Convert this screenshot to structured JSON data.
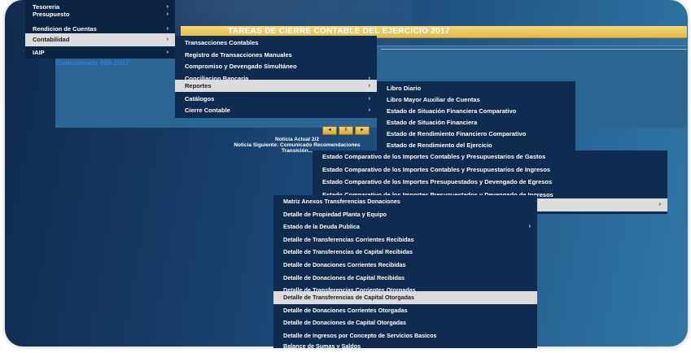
{
  "title": "TAREAS DE CIERRE CONTABLE DEL EJERCICIO 2017",
  "comunicado": "Comunicado 005-2017",
  "player": {
    "prev": "◄",
    "pause": "II",
    "next": "►"
  },
  "news": {
    "actual": "Noticia Actual 2/2",
    "siguiente": "Noticia Siguiente: Comunicado Recomendaciones",
    "transicion": "Transición..."
  },
  "menu_main": [
    {
      "label": "Tesoreria",
      "arrow": "›"
    },
    {
      "label": "Presupuesto",
      "arrow": "›"
    },
    {
      "label": "Rendicion de Cuentas",
      "arrow": "›"
    },
    {
      "label": "Contabilidad",
      "arrow": "›"
    },
    {
      "label": "IAIP",
      "arrow": "›"
    }
  ],
  "menu_contabilidad": [
    {
      "label": "Transacciones Contables",
      "arrow": ""
    },
    {
      "label": "Registro de Transacciones Manuales",
      "arrow": ""
    },
    {
      "label": "Compromiso y Devengado Simultáneo",
      "arrow": ""
    },
    {
      "label": "Conciliacion Bancaria",
      "arrow": "›"
    },
    {
      "label": "Reportes",
      "arrow": "›"
    },
    {
      "label": "Catálogos",
      "arrow": "›"
    },
    {
      "label": "Cierre Contable",
      "arrow": "›"
    }
  ],
  "menu_reportes": [
    {
      "label": "Libro Diario"
    },
    {
      "label": "Libro Mayor Auxiliar de Cuentas"
    },
    {
      "label": "Estado de Situación Financiera Comparativo"
    },
    {
      "label": "Estado de Situación Financiera"
    },
    {
      "label": "Estado de Rendimiento Financiero Comparativo"
    },
    {
      "label": "Estado de Rendimiento del Ejercicio"
    }
  ],
  "menu_comparativos": [
    {
      "label": "Estado Comparativo de los Importes Contables y Presupuestarios de Gastos",
      "arrow": ""
    },
    {
      "label": "Estado Comparativo de los Importes Contables y Presupuestarios de Ingresos",
      "arrow": ""
    },
    {
      "label": "Estado Comparativo de los Importes Presupuestados y Devengado de Egresos",
      "arrow": ""
    },
    {
      "label": "Estado Comparativo de los Importes Presupuestados y Devengado de Ingresos",
      "arrow": ""
    },
    {
      "label": "",
      "arrow": "›"
    }
  ],
  "menu_anexos": [
    {
      "label": "Matriz Anexos Transferencias Donaciones",
      "arrow": ""
    },
    {
      "label": "Detalle de Propiedad Planta y Equipo",
      "arrow": ""
    },
    {
      "label": "Estado de la Deuda Publica",
      "arrow": "›"
    },
    {
      "label": "Detalle de Transferencias Corrientes Recibidas",
      "arrow": ""
    },
    {
      "label": "Detalle de Transferencias de Capital Recibidas",
      "arrow": ""
    },
    {
      "label": "Detalle de Donaciones Corrientes Recibidas",
      "arrow": ""
    },
    {
      "label": "Detalle de Donaciones de Capital Recibidas",
      "arrow": ""
    },
    {
      "label": "Detalle de Transferencias Corrientes Otorgadas",
      "arrow": ""
    },
    {
      "label": "Detalle de Transferencias de Capital Otorgadas",
      "arrow": ""
    },
    {
      "label": "Detalle de Donaciones Corrientes Otorgadas",
      "arrow": ""
    },
    {
      "label": "Detalle de Donaciones de Capital Otorgadas",
      "arrow": ""
    },
    {
      "label": "Detalle de Ingresos por Concepto de Servicios Basicos",
      "arrow": ""
    },
    {
      "label": "Balance de Sumas y Saldos",
      "arrow": ""
    }
  ],
  "colors": {
    "title_bar": "#e5b944",
    "menu_bg": "#0f2b50",
    "active_item": "#dcdcdc",
    "comunicado": "#2d7fe2"
  }
}
